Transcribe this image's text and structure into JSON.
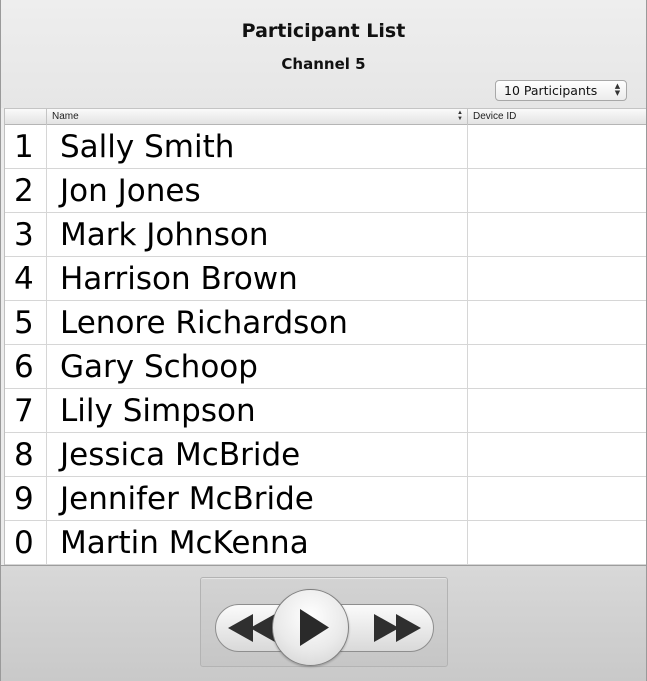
{
  "header": {
    "title": "Participant List",
    "subtitle": "Channel 5",
    "participants_select": "10 Participants"
  },
  "table": {
    "columns": {
      "number": "",
      "name": "Name",
      "device": "Device ID"
    },
    "rows": [
      {
        "number": "1",
        "name": "Sally Smith",
        "device": ""
      },
      {
        "number": "2",
        "name": "Jon Jones",
        "device": ""
      },
      {
        "number": "3",
        "name": "Mark Johnson",
        "device": ""
      },
      {
        "number": "4",
        "name": "Harrison Brown",
        "device": ""
      },
      {
        "number": "5",
        "name": "Lenore Richardson",
        "device": ""
      },
      {
        "number": "6",
        "name": "Gary Schoop",
        "device": ""
      },
      {
        "number": "7",
        "name": "Lily Simpson",
        "device": ""
      },
      {
        "number": "8",
        "name": "Jessica McBride",
        "device": ""
      },
      {
        "number": "9",
        "name": "Jennifer McBride",
        "device": ""
      },
      {
        "number": "0",
        "name": "Martin McKenna",
        "device": ""
      }
    ]
  },
  "controls": {
    "icons": [
      "rewind-icon",
      "play-icon",
      "fast-forward-icon"
    ]
  }
}
